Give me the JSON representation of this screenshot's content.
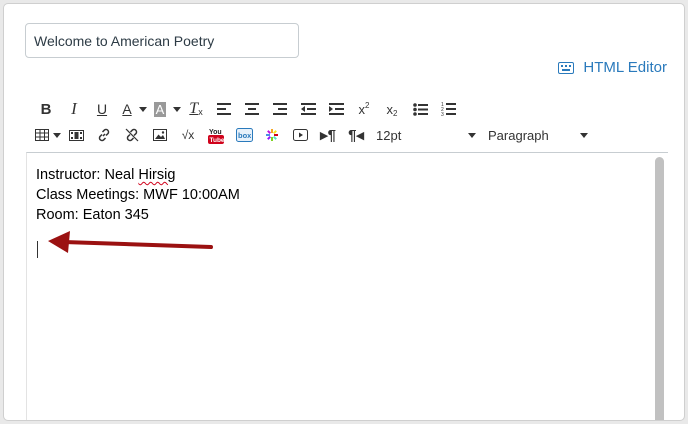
{
  "title_input": {
    "value": "Welcome to American Poetry"
  },
  "html_editor": {
    "label": "HTML Editor",
    "icon": "keyboard-icon"
  },
  "toolbar": {
    "row1": [
      "bold",
      "italic",
      "underline",
      "text-color",
      "background-color",
      "clear-formatting",
      "align-left",
      "align-center",
      "align-right",
      "outdent",
      "indent",
      "superscript",
      "subscript",
      "bullet-list",
      "numbered-list"
    ],
    "row2": [
      "table",
      "media",
      "link",
      "unlink",
      "image",
      "equation",
      "youtube",
      "box",
      "apps",
      "embed",
      "paragraph-ltr",
      "paragraph-rtl"
    ],
    "font_size": "12pt",
    "block_format": "Paragraph"
  },
  "content": {
    "line1_prefix": "Instructor: Neal ",
    "line1_misspelled": "Hirsig",
    "line2": "Class Meetings: MWF 10:00AM",
    "line3": "Room: Eaton 345"
  },
  "colors": {
    "link": "#2a7abc",
    "annotation_arrow": "#9b1111"
  }
}
